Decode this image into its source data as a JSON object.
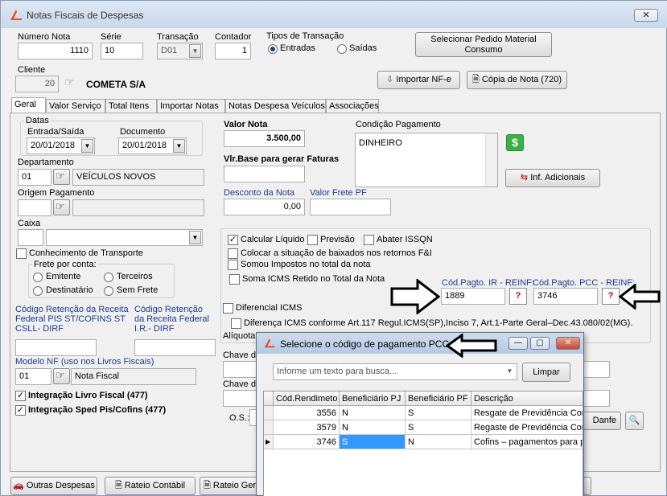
{
  "window": {
    "title": "Notas Fiscais de Despesas",
    "close": "✕"
  },
  "header": {
    "numero_nota": {
      "label": "Número Nota",
      "value": "1110"
    },
    "serie": {
      "label": "Série",
      "value": "10"
    },
    "transacao": {
      "label": "Transação",
      "value": "D01"
    },
    "contador": {
      "label": "Contador",
      "value": "1"
    },
    "tipos_transacao": {
      "label": "Tipos de Transação",
      "options": [
        "Entradas",
        "Saídas"
      ],
      "selected": "Entradas"
    },
    "selecionar_pedido": "Selecionar Pedido Material Consumo",
    "cliente": {
      "label": "Cliente",
      "code": "20",
      "name": "COMETA S/A"
    },
    "importar_nfe": "Importar NF-e",
    "copia_nota": "Cópia de Nota (720)"
  },
  "tabs": [
    "Geral",
    "Valor Serviço",
    "Total Itens",
    "Importar Notas",
    "Notas Despesa Veículos",
    "Associações"
  ],
  "geral": {
    "datas": {
      "label": "Datas",
      "entrada_label": "Entrada/Saída",
      "entrada_value": "20/01/2018",
      "documento_label": "Documento",
      "documento_value": "20/01/2018"
    },
    "departamento": {
      "label": "Departamento",
      "code": "01",
      "name": "VEÍCULOS NOVOS"
    },
    "origem_pagamento": {
      "label": "Origem Pagamento"
    },
    "caixa": {
      "label": "Caixa"
    },
    "conhecimento_transporte": "Conhecimento de Transporte",
    "frete": {
      "label": "Frete por conta:",
      "options": [
        "Emitente",
        "Terceiros",
        "Destinatário",
        "Sem Frete"
      ]
    },
    "codigo_ret_pis": "Código Retenção da Receita Federal PIS ST/COFINS ST CSLL- DIRF",
    "codigo_ret_ir": "Código Retenção da Receita Federal I.R.- DIRF",
    "modelo_nf": {
      "label": "Modelo NF (uso nos Livros Fiscais)",
      "code": "01",
      "name": "Nota Fiscal"
    },
    "integracao_livro": "Integração Livro Fiscal (477)",
    "integracao_sped": "Integração Sped Pis/Cofins (477)",
    "valor_nota": {
      "label": "Valor Nota",
      "value": "3.500,00"
    },
    "vlr_base": {
      "label": "Vlr.Base para gerar Faturas"
    },
    "desconto": {
      "label": "Desconto da Nota",
      "value": "0,00"
    },
    "valor_frete": {
      "label": "Valor Frete PF"
    },
    "condicao_pagamento": {
      "label": "Condição Pagamento",
      "value": "DINHEIRO"
    },
    "inf_adicionais": "Inf. Adicionais",
    "checks": {
      "calcular_liquido": "Calcular Líquido",
      "previsao": "Previsão",
      "abater_issqn": "Abater ISSQN",
      "colocar_situacao": "Colocar a situação de baixados nos retornos F&I",
      "somou_impostos": "Somou Impostos no total da nota",
      "soma_icms": "Soma ICMS Retido no Total da Nota",
      "diferencial_icms": "Diferencial ICMS",
      "diferenca_icms": "Diferença ICMS conforme Art.117 Regul.ICMS(SP),Inciso 7, Art.1-Parte Geral–Dec.43.080/02(MG)."
    },
    "cod_ir": {
      "label": "Cód.Pagto. IR - REINF:",
      "value": "1889"
    },
    "cod_pcc": {
      "label": "Cód.Pagto. PCC - REINF:",
      "value": "3746"
    },
    "aliquota": "Alíquota",
    "chave1": "Chave d",
    "chave2": "Chave d",
    "os": "O.S.:",
    "danfe": "Danfe"
  },
  "footer": {
    "outras_despesas": "Outras Despesas",
    "rateio_contabil": "Rateio Contábil",
    "rateio_ger": "Rateio Ger"
  },
  "dialog": {
    "title": "Selecione o código de pagamento PCC",
    "search_placeholder": "Informe um texto para busca...",
    "limpar": "Limpar",
    "columns": [
      "Cód.Rendimeto",
      "Beneficiário PJ",
      "Beneficiário PF",
      "Descrição"
    ],
    "rows": [
      [
        "3556",
        "N",
        "S",
        "Resgate de Previdência Com"
      ],
      [
        "3579",
        "N",
        "S",
        "Regaste de Previdência Com"
      ],
      [
        "3746",
        "S",
        "N",
        "Cofins – pagamentos para p"
      ]
    ]
  },
  "colors": {
    "accent": "#3399ff",
    "titlebar": "#c9d7ea",
    "logo": "#e0531d"
  }
}
